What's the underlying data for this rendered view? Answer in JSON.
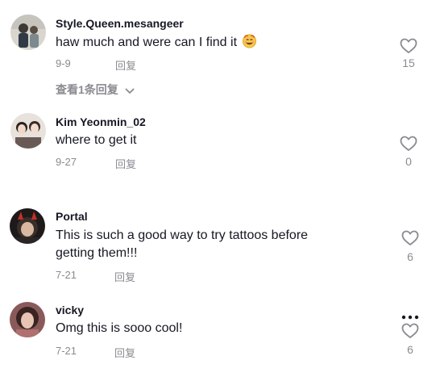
{
  "comments": [
    {
      "username": "Style.Queen.mesangeer",
      "text": "haw much and were can I find it",
      "emoji": "smiling-face-emoji",
      "date": "9-9",
      "reply_label": "回复",
      "likes": "15",
      "view_replies_label": "查看1条回复"
    },
    {
      "username": "Kim Yeonmin_02",
      "text": "where to get it",
      "date": "9-27",
      "reply_label": "回复",
      "likes": "0"
    },
    {
      "username": "Portal",
      "text_line1": "This is such a good way to try tattoos before",
      "text_line2": "getting them!!!",
      "date": "7-21",
      "reply_label": "回复",
      "likes": "6"
    },
    {
      "username": "vicky",
      "text": "Omg this is sooo cool!",
      "date": "7-21",
      "reply_label": "回复",
      "likes": "6"
    }
  ],
  "colors": {
    "primary_text": "#161823",
    "secondary_text": "#8a8b91",
    "icon": "#8a8b91"
  },
  "icons": {
    "like": "heart-outline-icon",
    "more": "more-dots-icon",
    "expand": "chevron-down-icon"
  }
}
